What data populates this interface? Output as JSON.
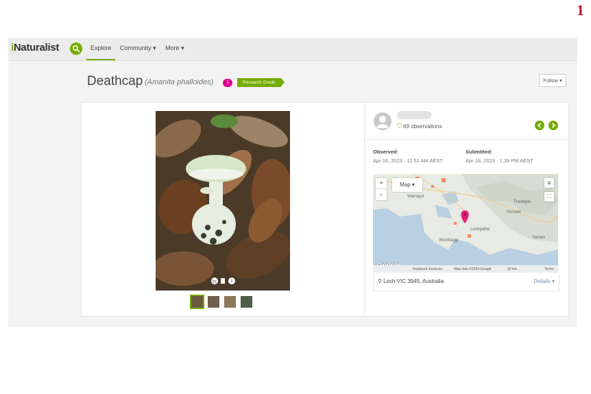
{
  "corner_number": "1",
  "topbar": {
    "logo": "iNaturalist",
    "nav": {
      "explore": "Explore",
      "community": "Community ▾",
      "more": "More ▾"
    }
  },
  "observation": {
    "common_name": "Deathcap",
    "scientific_name": "(Amanita phalloides)",
    "id_count": "1",
    "quality_grade": "Research Grade",
    "follow_label": "Follow ▾"
  },
  "user": {
    "observations_label": "69 observations"
  },
  "dates": {
    "observed_label": "Observed:",
    "observed_value": "Apr 16, 2023 · 11:51 AM AEST",
    "submitted_label": "Submitted:",
    "submitted_value": "Apr 18, 2023 · 1:39 PM AEST"
  },
  "map": {
    "type_label": "Map ▾",
    "zoom_in": "+",
    "zoom_out": "−",
    "attribution_logo": "Google",
    "footer_shortcuts": "Keyboard shortcuts",
    "footer_data": "Map data ©2024 Google",
    "footer_scale": "20 km",
    "footer_terms": "Terms",
    "places": {
      "warragul": "Warragul",
      "traralgon": "Traralgon",
      "morwell": "Morwell",
      "leongatha": "Leongatha",
      "yarram": "Yarram",
      "wonthaggi": "Wonthaggi"
    }
  },
  "location": {
    "text": "Loch VIC 3945, Australia",
    "details_label": "Details ▾"
  },
  "colors": {
    "brand_green": "#74ac00",
    "id_badge_pink": "#e0008c",
    "map_pin": "#e2227a"
  }
}
